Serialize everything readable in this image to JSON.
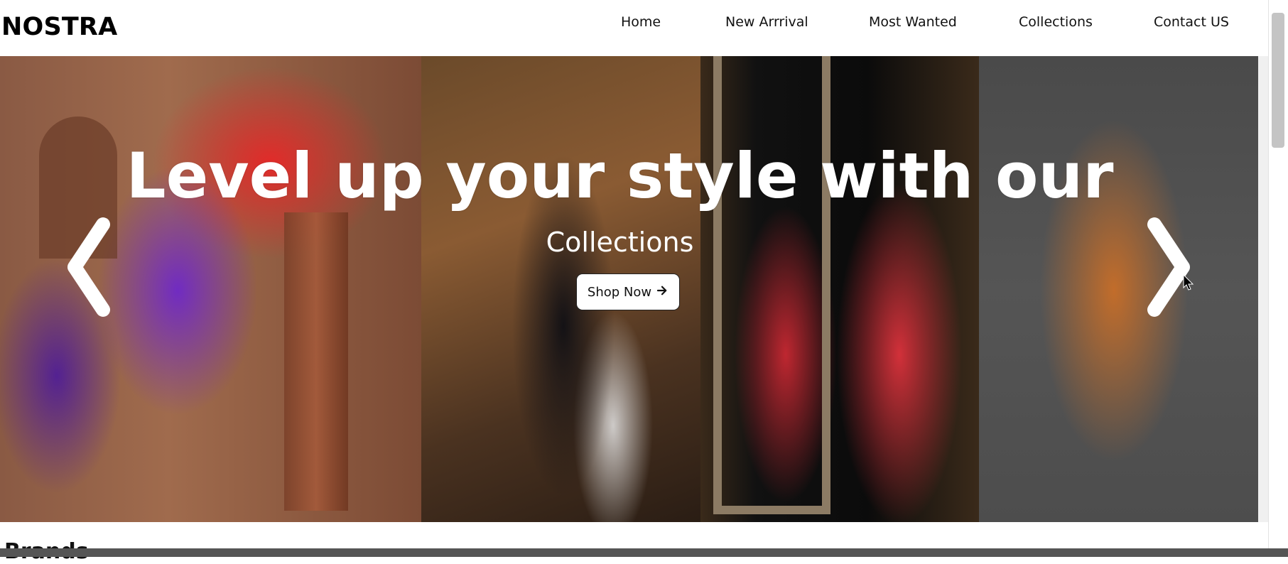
{
  "navbar": {
    "brand": "NOSTRA",
    "links": [
      "Home",
      "New Arrrival",
      "Most Wanted",
      "Collections",
      "Contact US"
    ]
  },
  "hero": {
    "title": "Level up your style with our",
    "subtitle": "Collections",
    "cta_label": "Shop Now",
    "cta_icon": "arrow-right-icon",
    "prev_icon": "chevron-left-icon",
    "next_icon": "chevron-right-icon"
  },
  "section": {
    "brands_title": "Brands"
  },
  "colors": {
    "navbar_bg": "#ffffff",
    "hero_text": "#ffffff",
    "button_bg": "#ffffff"
  }
}
